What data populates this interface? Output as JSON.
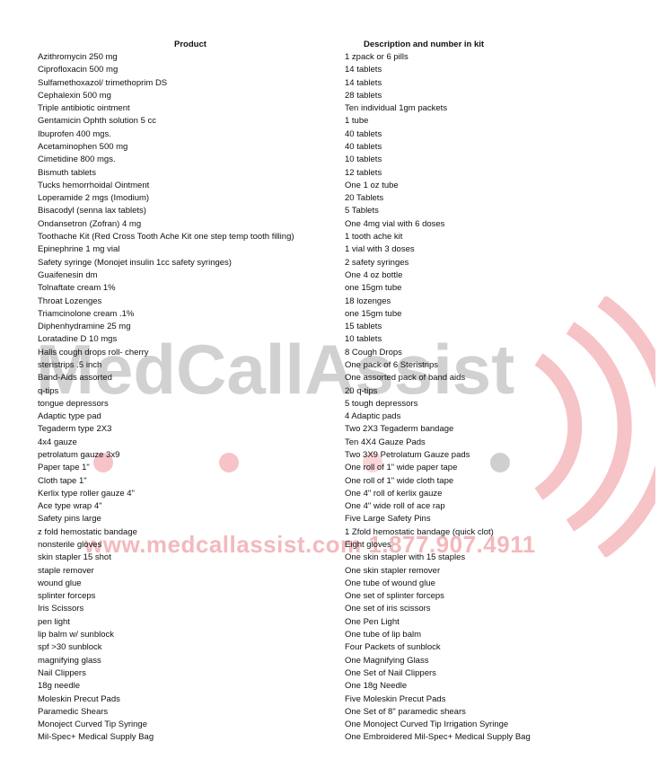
{
  "watermark": {
    "brand": "MedCallAssist",
    "contact": "www.medcallassist.com   1.877.907.4911",
    "colors": {
      "gray": "#c9c9c9",
      "red": "#f3b9bd"
    }
  },
  "table": {
    "headers": [
      "Product",
      "Description and number in kit"
    ],
    "rows": [
      [
        "Azithromycin 250 mg",
        "1 zpack or 6 pills"
      ],
      [
        "Ciprofloxacin 500 mg",
        "14 tablets"
      ],
      [
        "Sulfamethoxazol/ trimethoprim DS",
        "14 tablets"
      ],
      [
        "Cephalexin 500 mg",
        "28 tablets"
      ],
      [
        "Triple antibiotic ointment",
        "Ten individual 1gm packets"
      ],
      [
        "Gentamicin Ophth solution 5 cc",
        "1 tube"
      ],
      [
        "Ibuprofen 400 mgs.",
        "40 tablets"
      ],
      [
        "Acetaminophen 500 mg",
        "40 tablets"
      ],
      [
        "Cimetidine 800 mgs.",
        "10 tablets"
      ],
      [
        "Bismuth tablets",
        "12 tablets"
      ],
      [
        "Tucks hemorrhoidal Ointment",
        "One 1 oz tube"
      ],
      [
        "Loperamide 2 mgs (Imodium)",
        "20 Tablets"
      ],
      [
        "Bisacodyl (senna lax tablets)",
        "5 Tablets"
      ],
      [
        "Ondansetron (Zofran) 4 mg",
        "One 4mg vial with 6 doses"
      ],
      [
        "Toothache Kit (Red Cross Tooth Ache Kit one step temp tooth filling)",
        "1 tooth ache kit"
      ],
      [
        "Epinephrine 1 mg vial",
        "1 vial with 3 doses"
      ],
      [
        "Safety syringe (Monojet insulin 1cc safety syringes)",
        "2 safety syringes"
      ],
      [
        "Guaifenesin dm",
        "One 4 oz bottle"
      ],
      [
        "Tolnaftate cream 1%",
        "one 15gm tube"
      ],
      [
        "Throat Lozenges",
        "18 lozenges"
      ],
      [
        "Triamcinolone cream .1%",
        "one 15gm tube"
      ],
      [
        "Diphenhydramine 25 mg",
        "15 tablets"
      ],
      [
        "Loratadine D 10 mgs",
        "10 tablets"
      ],
      [
        "Halls cough drops roll- cherry",
        "8 Cough Drops"
      ],
      [
        "steristrips .5 inch",
        "One pack of 6 Steristrips"
      ],
      [
        "Band-Aids assorted",
        "One assorted pack of band aids"
      ],
      [
        "q-tips",
        "20 q-tips"
      ],
      [
        "tongue depressors",
        "5 tough depressors"
      ],
      [
        "Adaptic type pad",
        "4 Adaptic pads"
      ],
      [
        "Tegaderm type 2X3",
        "Two 2X3 Tegaderm bandage"
      ],
      [
        "4x4 gauze",
        "Ten 4X4 Gauze Pads"
      ],
      [
        "petrolatum gauze 3x9",
        "Two 3X9 Petrolatum Gauze pads"
      ],
      [
        "Paper tape 1\"",
        "One roll of 1\" wide paper tape"
      ],
      [
        "Cloth tape 1\"",
        "One roll of 1\" wide cloth tape"
      ],
      [
        "Kerlix type roller gauze 4\"",
        "One 4\" roll of kerlix gauze"
      ],
      [
        "Ace type wrap 4\"",
        "One 4\" wide roll of ace rap"
      ],
      [
        "Safety pins large",
        "Five Large Safety Pins"
      ],
      [
        "z fold hemostatic bandage",
        "1 Zfold hemostatic bandage (quick clot)"
      ],
      [
        "nonsterile gloves",
        "Eight gloves"
      ],
      [
        "skin stapler 15 shot",
        "One skin stapler with 15 staples"
      ],
      [
        "staple remover",
        "One skin stapler remover"
      ],
      [
        "wound glue",
        "One tube of wound glue"
      ],
      [
        "splinter forceps",
        "One set of splinter forceps"
      ],
      [
        "Iris Scissors",
        "One set of iris scissors"
      ],
      [
        "pen light",
        "One Pen Light"
      ],
      [
        "lip balm w/ sunblock",
        "One tube of lip balm"
      ],
      [
        "spf >30 sunblock",
        "Four Packets of sunblock"
      ],
      [
        "magnifying glass",
        "One Magnifying Glass"
      ],
      [
        "Nail Clippers",
        "One Set of Nail Clippers"
      ],
      [
        "18g needle",
        "One 18g Needle"
      ],
      [
        "Moleskin Precut Pads",
        "Five Moleskin Precut Pads"
      ],
      [
        "Paramedic Shears",
        "One Set of 8\" paramedic shears"
      ],
      [
        "Monoject Curved Tip Syringe",
        "One Monoject Curved Tip Irrigation Syringe"
      ],
      [
        "Mil-Spec+ Medical Supply Bag",
        "One Embroidered Mil-Spec+ Medical Supply Bag"
      ]
    ]
  }
}
